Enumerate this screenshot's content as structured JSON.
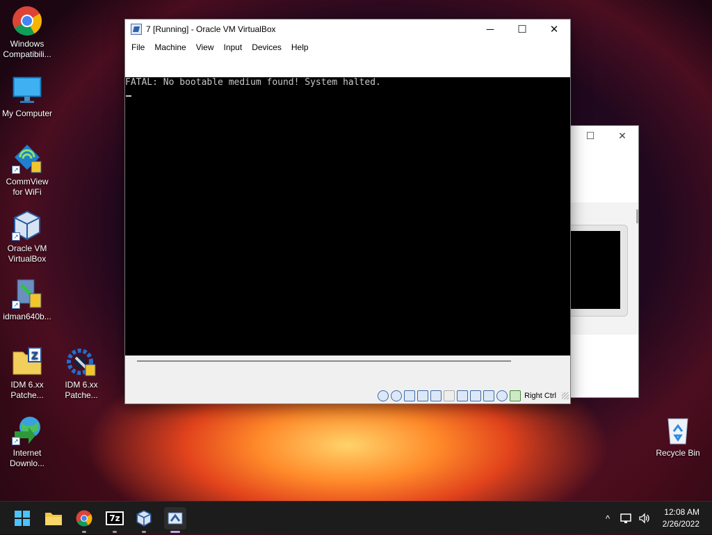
{
  "desktop": {
    "icons": [
      {
        "label_1": "Windows",
        "label_2": "Compatibili..."
      },
      {
        "label_1": "My Computer",
        "label_2": ""
      },
      {
        "label_1": "CommView",
        "label_2": "for WiFi"
      },
      {
        "label_1": "Oracle VM",
        "label_2": "VirtualBox"
      },
      {
        "label_1": "idman640b...",
        "label_2": ""
      },
      {
        "label_1": "IDM 6.xx",
        "label_2": "Patche..."
      },
      {
        "label_1": "IDM 6.xx",
        "label_2": "Patche..."
      },
      {
        "label_1": "Internet",
        "label_2": "Downlo..."
      },
      {
        "label_1": "Recycle Bin",
        "label_2": ""
      }
    ]
  },
  "vbox_window": {
    "title": "7 [Running] - Oracle VM VirtualBox",
    "controls": {
      "minimize": "─",
      "maximize": "☐",
      "close": "✕"
    },
    "menu": [
      "File",
      "Machine",
      "View",
      "Input",
      "Devices",
      "Help"
    ],
    "console_message": "FATAL: No bootable medium found! System halted.",
    "host_key": "Right Ctrl"
  },
  "background_window": {
    "controls": {
      "maximize": "☐",
      "close": "✕"
    }
  },
  "taskbar": {
    "apps": [
      {
        "icon": "windows-start-icon"
      },
      {
        "icon": "file-explorer-icon"
      },
      {
        "icon": "chrome-icon"
      },
      {
        "icon": "7zip-icon",
        "label": "7z"
      },
      {
        "icon": "virtualbox-icon"
      },
      {
        "icon": "virtualbox-vm-icon"
      }
    ],
    "tray": {
      "chevron": "^"
    },
    "clock": {
      "time": "12:08 AM",
      "date": "2/26/2022"
    }
  },
  "colors": {
    "accent_active": "#c6a3e3",
    "console_text": "#c8c8c8"
  }
}
